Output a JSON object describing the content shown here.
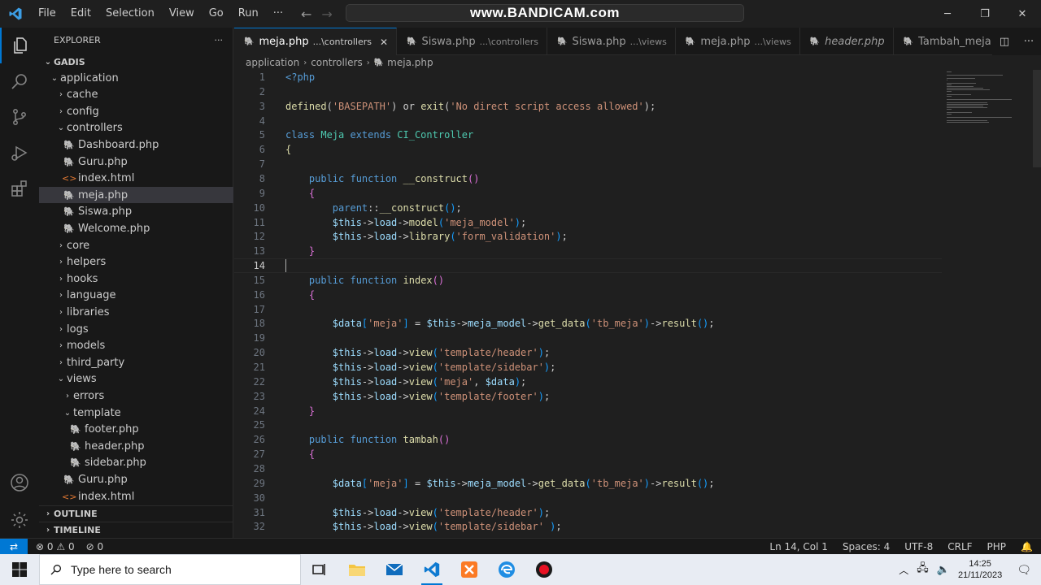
{
  "app": {
    "menu": [
      "File",
      "Edit",
      "Selection",
      "View",
      "Go",
      "Run"
    ],
    "more_label": "···",
    "search_text": "www.BANDICAM.com"
  },
  "explorer": {
    "title": "EXPLORER",
    "root": "GADIS",
    "tree": [
      {
        "label": "application",
        "depth": 1,
        "kind": "folder-open"
      },
      {
        "label": "cache",
        "depth": 2,
        "kind": "folder"
      },
      {
        "label": "config",
        "depth": 2,
        "kind": "folder"
      },
      {
        "label": "controllers",
        "depth": 2,
        "kind": "folder-open"
      },
      {
        "label": "Dashboard.php",
        "depth": 3,
        "kind": "php"
      },
      {
        "label": "Guru.php",
        "depth": 3,
        "kind": "php"
      },
      {
        "label": "index.html",
        "depth": 3,
        "kind": "html"
      },
      {
        "label": "meja.php",
        "depth": 3,
        "kind": "php",
        "selected": true
      },
      {
        "label": "Siswa.php",
        "depth": 3,
        "kind": "php"
      },
      {
        "label": "Welcome.php",
        "depth": 3,
        "kind": "php"
      },
      {
        "label": "core",
        "depth": 2,
        "kind": "folder"
      },
      {
        "label": "helpers",
        "depth": 2,
        "kind": "folder"
      },
      {
        "label": "hooks",
        "depth": 2,
        "kind": "folder"
      },
      {
        "label": "language",
        "depth": 2,
        "kind": "folder"
      },
      {
        "label": "libraries",
        "depth": 2,
        "kind": "folder"
      },
      {
        "label": "logs",
        "depth": 2,
        "kind": "folder"
      },
      {
        "label": "models",
        "depth": 2,
        "kind": "folder"
      },
      {
        "label": "third_party",
        "depth": 2,
        "kind": "folder"
      },
      {
        "label": "views",
        "depth": 2,
        "kind": "folder-open"
      },
      {
        "label": "errors",
        "depth": 3,
        "kind": "folder"
      },
      {
        "label": "template",
        "depth": 3,
        "kind": "folder-open"
      },
      {
        "label": "footer.php",
        "depth": 4,
        "kind": "php"
      },
      {
        "label": "header.php",
        "depth": 4,
        "kind": "php"
      },
      {
        "label": "sidebar.php",
        "depth": 4,
        "kind": "php"
      },
      {
        "label": "Guru.php",
        "depth": 3,
        "kind": "php"
      },
      {
        "label": "index.html",
        "depth": 3,
        "kind": "html"
      }
    ],
    "outline_label": "OUTLINE",
    "timeline_label": "TIMELINE"
  },
  "tabs": [
    {
      "name": "meja.php",
      "desc": "...\\controllers",
      "active": true
    },
    {
      "name": "Siswa.php",
      "desc": "...\\controllers",
      "active": false
    },
    {
      "name": "Siswa.php",
      "desc": "...\\views",
      "active": false
    },
    {
      "name": "meja.php",
      "desc": "...\\views",
      "active": false
    },
    {
      "name": "header.php",
      "desc": "",
      "active": false
    },
    {
      "name": "Tambah_meja.php",
      "desc": "",
      "active": false
    }
  ],
  "breadcrumb": [
    "application",
    "controllers",
    "meja.php"
  ],
  "code": {
    "current_line": 14,
    "lines": [
      [
        [
          "kw",
          "<?php"
        ]
      ],
      [],
      [
        [
          "fn",
          "defined"
        ],
        [
          "pl",
          "("
        ],
        [
          "str",
          "'BASEPATH'"
        ],
        [
          "pl",
          ") "
        ],
        [
          "pl",
          "or "
        ],
        [
          "fn",
          "exit"
        ],
        [
          "pl",
          "("
        ],
        [
          "str",
          "'No direct script access allowed'"
        ],
        [
          "pl",
          ");"
        ]
      ],
      [],
      [
        [
          "kw",
          "class "
        ],
        [
          "cls",
          "Meja "
        ],
        [
          "kw",
          "extends "
        ],
        [
          "cls",
          "CI_Controller"
        ]
      ],
      [
        [
          "fn",
          "{"
        ]
      ],
      [],
      [
        [
          "pl",
          "    "
        ],
        [
          "kw",
          "public "
        ],
        [
          "kw",
          "function "
        ],
        [
          "fn",
          "__construct"
        ],
        [
          "brc",
          "()"
        ]
      ],
      [
        [
          "pl",
          "    "
        ],
        [
          "brc",
          "{"
        ]
      ],
      [
        [
          "pl",
          "        "
        ],
        [
          "kw",
          "parent"
        ],
        [
          "pl",
          "::"
        ],
        [
          "fn",
          "__construct"
        ],
        [
          "brc2",
          "()"
        ],
        [
          "pl",
          ";"
        ]
      ],
      [
        [
          "pl",
          "        "
        ],
        [
          "var",
          "$this"
        ],
        [
          "pl",
          "->"
        ],
        [
          "var",
          "load"
        ],
        [
          "pl",
          "->"
        ],
        [
          "fn",
          "model"
        ],
        [
          "brc2",
          "("
        ],
        [
          "str",
          "'meja_model'"
        ],
        [
          "brc2",
          ")"
        ],
        [
          "pl",
          ";"
        ]
      ],
      [
        [
          "pl",
          "        "
        ],
        [
          "var",
          "$this"
        ],
        [
          "pl",
          "->"
        ],
        [
          "var",
          "load"
        ],
        [
          "pl",
          "->"
        ],
        [
          "fn",
          "library"
        ],
        [
          "brc2",
          "("
        ],
        [
          "str",
          "'form_validation'"
        ],
        [
          "brc2",
          ")"
        ],
        [
          "pl",
          ";"
        ]
      ],
      [
        [
          "pl",
          "    "
        ],
        [
          "brc",
          "}"
        ]
      ],
      [],
      [
        [
          "pl",
          "    "
        ],
        [
          "kw",
          "public "
        ],
        [
          "kw",
          "function "
        ],
        [
          "fn",
          "index"
        ],
        [
          "brc",
          "()"
        ]
      ],
      [
        [
          "pl",
          "    "
        ],
        [
          "brc",
          "{"
        ]
      ],
      [],
      [
        [
          "pl",
          "        "
        ],
        [
          "var",
          "$data"
        ],
        [
          "brc2",
          "["
        ],
        [
          "str",
          "'meja'"
        ],
        [
          "brc2",
          "]"
        ],
        [
          "pl",
          " = "
        ],
        [
          "var",
          "$this"
        ],
        [
          "pl",
          "->"
        ],
        [
          "var",
          "meja_model"
        ],
        [
          "pl",
          "->"
        ],
        [
          "fn",
          "get_data"
        ],
        [
          "brc2",
          "("
        ],
        [
          "str",
          "'tb_meja'"
        ],
        [
          "brc2",
          ")"
        ],
        [
          "pl",
          "->"
        ],
        [
          "fn",
          "result"
        ],
        [
          "brc2",
          "()"
        ],
        [
          "pl",
          ";"
        ]
      ],
      [],
      [
        [
          "pl",
          "        "
        ],
        [
          "var",
          "$this"
        ],
        [
          "pl",
          "->"
        ],
        [
          "var",
          "load"
        ],
        [
          "pl",
          "->"
        ],
        [
          "fn",
          "view"
        ],
        [
          "brc2",
          "("
        ],
        [
          "str",
          "'template/header'"
        ],
        [
          "brc2",
          ")"
        ],
        [
          "pl",
          ";"
        ]
      ],
      [
        [
          "pl",
          "        "
        ],
        [
          "var",
          "$this"
        ],
        [
          "pl",
          "->"
        ],
        [
          "var",
          "load"
        ],
        [
          "pl",
          "->"
        ],
        [
          "fn",
          "view"
        ],
        [
          "brc2",
          "("
        ],
        [
          "str",
          "'template/sidebar'"
        ],
        [
          "brc2",
          ")"
        ],
        [
          "pl",
          ";"
        ]
      ],
      [
        [
          "pl",
          "        "
        ],
        [
          "var",
          "$this"
        ],
        [
          "pl",
          "->"
        ],
        [
          "var",
          "load"
        ],
        [
          "pl",
          "->"
        ],
        [
          "fn",
          "view"
        ],
        [
          "brc2",
          "("
        ],
        [
          "str",
          "'meja'"
        ],
        [
          "pl",
          ", "
        ],
        [
          "var",
          "$data"
        ],
        [
          "brc2",
          ")"
        ],
        [
          "pl",
          ";"
        ]
      ],
      [
        [
          "pl",
          "        "
        ],
        [
          "var",
          "$this"
        ],
        [
          "pl",
          "->"
        ],
        [
          "var",
          "load"
        ],
        [
          "pl",
          "->"
        ],
        [
          "fn",
          "view"
        ],
        [
          "brc2",
          "("
        ],
        [
          "str",
          "'template/footer'"
        ],
        [
          "brc2",
          ")"
        ],
        [
          "pl",
          ";"
        ]
      ],
      [
        [
          "pl",
          "    "
        ],
        [
          "brc",
          "}"
        ]
      ],
      [],
      [
        [
          "pl",
          "    "
        ],
        [
          "kw",
          "public "
        ],
        [
          "kw",
          "function "
        ],
        [
          "fn",
          "tambah"
        ],
        [
          "brc",
          "()"
        ]
      ],
      [
        [
          "pl",
          "    "
        ],
        [
          "brc",
          "{"
        ]
      ],
      [],
      [
        [
          "pl",
          "        "
        ],
        [
          "var",
          "$data"
        ],
        [
          "brc2",
          "["
        ],
        [
          "str",
          "'meja'"
        ],
        [
          "brc2",
          "]"
        ],
        [
          "pl",
          " = "
        ],
        [
          "var",
          "$this"
        ],
        [
          "pl",
          "->"
        ],
        [
          "var",
          "meja_model"
        ],
        [
          "pl",
          "->"
        ],
        [
          "fn",
          "get_data"
        ],
        [
          "brc2",
          "("
        ],
        [
          "str",
          "'tb_meja'"
        ],
        [
          "brc2",
          ")"
        ],
        [
          "pl",
          "->"
        ],
        [
          "fn",
          "result"
        ],
        [
          "brc2",
          "()"
        ],
        [
          "pl",
          ";"
        ]
      ],
      [],
      [
        [
          "pl",
          "        "
        ],
        [
          "var",
          "$this"
        ],
        [
          "pl",
          "->"
        ],
        [
          "var",
          "load"
        ],
        [
          "pl",
          "->"
        ],
        [
          "fn",
          "view"
        ],
        [
          "brc2",
          "("
        ],
        [
          "str",
          "'template/header'"
        ],
        [
          "brc2",
          ")"
        ],
        [
          "pl",
          ";"
        ]
      ],
      [
        [
          "pl",
          "        "
        ],
        [
          "var",
          "$this"
        ],
        [
          "pl",
          "->"
        ],
        [
          "var",
          "load"
        ],
        [
          "pl",
          "->"
        ],
        [
          "fn",
          "view"
        ],
        [
          "brc2",
          "("
        ],
        [
          "str",
          "'template/sidebar' "
        ],
        [
          "brc2",
          ")"
        ],
        [
          "pl",
          ";"
        ]
      ]
    ]
  },
  "status": {
    "remote_icon": "remote-icon",
    "errors": "0",
    "warnings": "0",
    "ports": "0",
    "position": "Ln 14, Col 1",
    "spaces": "Spaces: 4",
    "encoding": "UTF-8",
    "eol": "CRLF",
    "language": "PHP"
  },
  "taskbar": {
    "search_placeholder": "Type here to search",
    "time": "14:25",
    "date": "21/11/2023"
  },
  "colors": {
    "accent": "#0078d4",
    "php_icon": "#a074c4",
    "html_icon": "#e37933"
  }
}
